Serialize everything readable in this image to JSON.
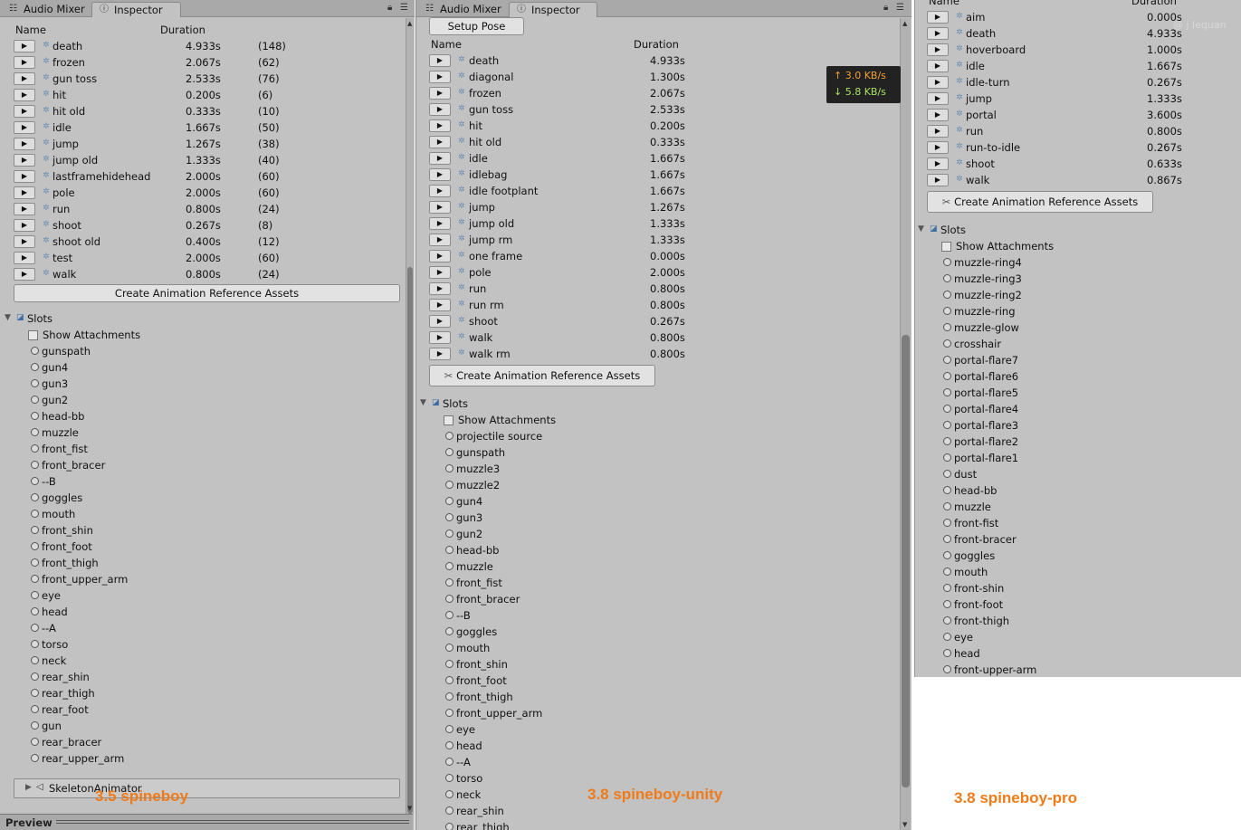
{
  "tabs": {
    "audio_mixer": "Audio Mixer",
    "inspector": "Inspector"
  },
  "columns": {
    "name": "Name",
    "duration": "Duration"
  },
  "create_button": "Create Animation Reference Assets",
  "setup_pose": "Setup Pose",
  "slots_label": "Slots",
  "show_attachments": "Show Attachments",
  "network": {
    "up": "↑ 3.0 KB/s",
    "down": "↓ 5.8 KB/s"
  },
  "watermark": "@ j lequan",
  "captions": {
    "p1": "3.5 spineboy",
    "p2": "3.8 spineboy-unity",
    "p3": "3.8 spineboy-pro"
  },
  "preview_label": "Preview",
  "skeleton_animator": "SkeletonAnimator",
  "panel1": {
    "animations": [
      {
        "name": "death",
        "duration": "4.933s",
        "frames": "(148)"
      },
      {
        "name": "frozen",
        "duration": "2.067s",
        "frames": "(62)"
      },
      {
        "name": "gun toss",
        "duration": "2.533s",
        "frames": "(76)"
      },
      {
        "name": "hit",
        "duration": "0.200s",
        "frames": "(6)"
      },
      {
        "name": "hit old",
        "duration": "0.333s",
        "frames": "(10)"
      },
      {
        "name": "idle",
        "duration": "1.667s",
        "frames": "(50)"
      },
      {
        "name": "jump",
        "duration": "1.267s",
        "frames": "(38)"
      },
      {
        "name": "jump old",
        "duration": "1.333s",
        "frames": "(40)"
      },
      {
        "name": "lastframehidehead",
        "duration": "2.000s",
        "frames": "(60)"
      },
      {
        "name": "pole",
        "duration": "2.000s",
        "frames": "(60)"
      },
      {
        "name": "run",
        "duration": "0.800s",
        "frames": "(24)"
      },
      {
        "name": "shoot",
        "duration": "0.267s",
        "frames": "(8)"
      },
      {
        "name": "shoot old",
        "duration": "0.400s",
        "frames": "(12)"
      },
      {
        "name": "test",
        "duration": "2.000s",
        "frames": "(60)"
      },
      {
        "name": "walk",
        "duration": "0.800s",
        "frames": "(24)"
      }
    ],
    "slots": [
      "gunspath",
      "gun4",
      "gun3",
      "gun2",
      "head-bb",
      "muzzle",
      "front_fist",
      "front_bracer",
      "--B",
      "goggles",
      "mouth",
      "front_shin",
      "front_foot",
      "front_thigh",
      "front_upper_arm",
      "eye",
      "head",
      "--A",
      "torso",
      "neck",
      "rear_shin",
      "rear_thigh",
      "rear_foot",
      "gun",
      "rear_bracer",
      "rear_upper_arm"
    ]
  },
  "panel2": {
    "animations": [
      {
        "name": "death",
        "duration": "4.933s"
      },
      {
        "name": "diagonal",
        "duration": "1.300s"
      },
      {
        "name": "frozen",
        "duration": "2.067s"
      },
      {
        "name": "gun toss",
        "duration": "2.533s"
      },
      {
        "name": "hit",
        "duration": "0.200s"
      },
      {
        "name": "hit old",
        "duration": "0.333s"
      },
      {
        "name": "idle",
        "duration": "1.667s"
      },
      {
        "name": "idlebag",
        "duration": "1.667s"
      },
      {
        "name": "idle footplant",
        "duration": "1.667s"
      },
      {
        "name": "jump",
        "duration": "1.267s"
      },
      {
        "name": "jump old",
        "duration": "1.333s"
      },
      {
        "name": "jump rm",
        "duration": "1.333s"
      },
      {
        "name": "one frame",
        "duration": "0.000s"
      },
      {
        "name": "pole",
        "duration": "2.000s"
      },
      {
        "name": "run",
        "duration": "0.800s"
      },
      {
        "name": "run rm",
        "duration": "0.800s"
      },
      {
        "name": "shoot",
        "duration": "0.267s"
      },
      {
        "name": "walk",
        "duration": "0.800s"
      },
      {
        "name": "walk rm",
        "duration": "0.800s"
      }
    ],
    "slots": [
      "projectile source",
      "gunspath",
      "muzzle3",
      "muzzle2",
      "gun4",
      "gun3",
      "gun2",
      "head-bb",
      "muzzle",
      "front_fist",
      "front_bracer",
      "--B",
      "goggles",
      "mouth",
      "front_shin",
      "front_foot",
      "front_thigh",
      "front_upper_arm",
      "eye",
      "head",
      "--A",
      "torso",
      "neck",
      "rear_shin",
      "rear_thigh"
    ]
  },
  "panel3": {
    "animations": [
      {
        "name": "aim",
        "duration": "0.000s"
      },
      {
        "name": "death",
        "duration": "4.933s"
      },
      {
        "name": "hoverboard",
        "duration": "1.000s"
      },
      {
        "name": "idle",
        "duration": "1.667s"
      },
      {
        "name": "idle-turn",
        "duration": "0.267s"
      },
      {
        "name": "jump",
        "duration": "1.333s"
      },
      {
        "name": "portal",
        "duration": "3.600s"
      },
      {
        "name": "run",
        "duration": "0.800s"
      },
      {
        "name": "run-to-idle",
        "duration": "0.267s"
      },
      {
        "name": "shoot",
        "duration": "0.633s"
      },
      {
        "name": "walk",
        "duration": "0.867s"
      }
    ],
    "slots": [
      "muzzle-ring4",
      "muzzle-ring3",
      "muzzle-ring2",
      "muzzle-ring",
      "muzzle-glow",
      "crosshair",
      "portal-flare7",
      "portal-flare6",
      "portal-flare5",
      "portal-flare4",
      "portal-flare3",
      "portal-flare2",
      "portal-flare1",
      "dust",
      "head-bb",
      "muzzle",
      "front-fist",
      "front-bracer",
      "goggles",
      "mouth",
      "front-shin",
      "front-foot",
      "front-thigh",
      "eye",
      "head",
      "front-upper-arm"
    ]
  }
}
